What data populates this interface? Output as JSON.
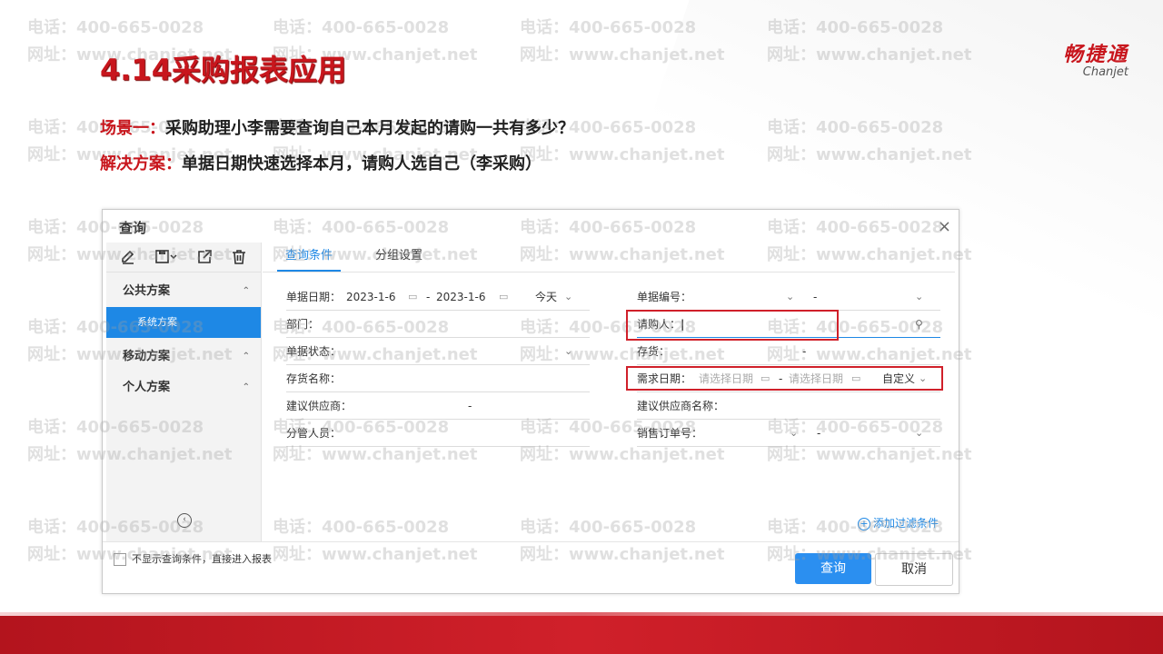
{
  "slide": {
    "title": "4.14采购报表应用",
    "scene_label": "场景一：",
    "scene_text": "采购助理小李需要查询自己本月发起的请购一共有多少？",
    "solution_label": "解决方案：",
    "solution_text": "单据日期快速选择本月，请购人选自己（李采购）"
  },
  "logo": {
    "cn": "畅捷通",
    "en": "Chanjet"
  },
  "watermark": {
    "line1": "电话：400-665-0028",
    "line2": "网址：www.chanjet.net"
  },
  "dialog": {
    "title": "查询",
    "close_icon": "×",
    "toolbar": [
      "edit-icon",
      "save-icon",
      "export-icon",
      "delete-icon"
    ],
    "schemes": {
      "public": "公共方案",
      "system": "系统方案",
      "mobile": "移动方案",
      "personal": "个人方案"
    },
    "tabs": {
      "query": "查询条件",
      "group": "分组设置"
    },
    "fields": {
      "doc_date_label": "单据日期：",
      "doc_date_from": "2023-1-6",
      "doc_date_to": "2023-1-6",
      "doc_date_preset": "今天",
      "doc_no_label": "单据编号：",
      "dept_label": "部门：",
      "requester_label": "请购人：",
      "status_label": "单据状态：",
      "inventory_label": "存货：",
      "inventory_name_label": "存货名称：",
      "need_date_label": "需求日期：",
      "need_date_from_placeholder": "请选择日期",
      "need_date_to_placeholder": "请选择日期",
      "need_date_preset": "自定义",
      "supplier_label": "建议供应商：",
      "supplier_name_label": "建议供应商名称：",
      "manager_label": "分管人员：",
      "sales_order_label": "销售订单号：",
      "dash": "-"
    },
    "add_filter": "添加过滤条件",
    "footer": {
      "skip_label": "不显示查询条件，直接进入报表",
      "query_button": "查询",
      "cancel_button": "取消"
    }
  }
}
